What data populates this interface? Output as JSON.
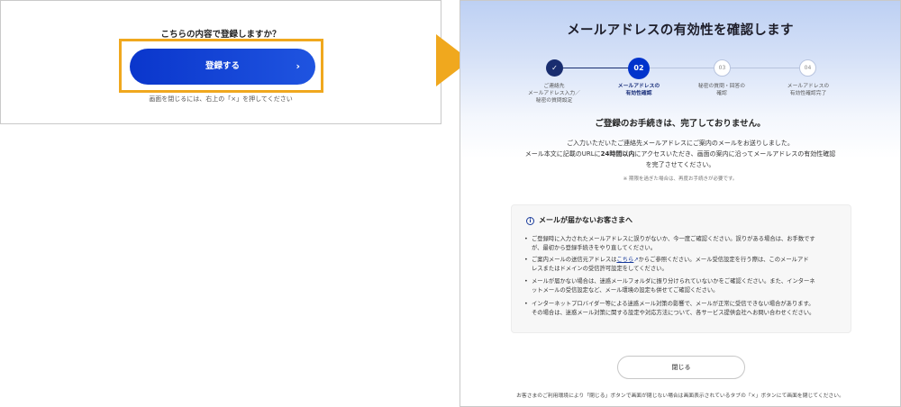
{
  "left_panel": {
    "question": "こちらの内容で登録しますか？",
    "register_button": "登録する",
    "register_chevron": "›",
    "close_note": "画面を閉じるには、右上の「×」を押してください"
  },
  "right_panel": {
    "title": "メールアドレスの有効性を確認します",
    "steps": [
      {
        "num": "✓",
        "label": "ご連絡先\nメールアドレス入力／\n秘密の質問設定",
        "state": "done"
      },
      {
        "num": "02",
        "label": "メールアドレスの\n有効性確認",
        "state": "current"
      },
      {
        "num": "03",
        "label": "秘密の質問・回答の\n確認",
        "state": "todo"
      },
      {
        "num": "04",
        "label": "メールアドレスの\n有効性確認完了",
        "state": "todo"
      }
    ],
    "status_heading": "ご登録のお手続きは、完了しておりません。",
    "info_line1": "ご入力いただいたご連絡先メールアドレスにご案内のメールをお送りしました。",
    "info_line2_pre": "メール本文に記載のURLに",
    "info_line2_bold": "24時間以内",
    "info_line2_post": "にアクセスいただき、画面の案内に沿ってメールアドレスの有効性確認",
    "info_line3": "を完了させてください。",
    "small_note": "※ 期限を過ぎた場合は、再度お手続きが必要です。",
    "notice": {
      "icon": "i",
      "title": "メールが届かないお客さまへ",
      "bullet": "•",
      "items": [
        {
          "text1": "ご登録時に入力されたメールアドレスに誤りがないか、今一度ご確認ください。誤りがある場合は、お手数です",
          "text2": "が、最初から登録手続きをやり直してください。"
        },
        {
          "pre": "ご案内メールの送信元アドレスは",
          "link": "こちら",
          "link_icon": "↗",
          "post": "からご参照ください。メール受信設定を行う際は、このメールアド",
          "text2": "レスまたはドメインの受信許可設定をしてください。"
        },
        {
          "text1": "メールが届かない場合は、迷惑メールフォルダに振り分けられていないかをご確認ください。また、インターネ",
          "text2": "ットメールの受信設定など、メール環境の設定も併せてご確認ください。"
        },
        {
          "text1": "インターネットプロバイダー等による迷惑メール対策の影響で、メールが正常に受信できない場合があります。",
          "text2": "その場合は、迷惑メール対策に関する設定や対応方法について、各サービス提供会社へお問い合わせください。"
        }
      ]
    },
    "close_button": "閉じる",
    "footer_note": "お客さまのご利用環境により「閉じる」ボタンで画面が閉じない場合は画面表示されているタブの「×」ボタンにて画面を閉じてください。"
  },
  "colors": {
    "accent_orange": "#f0a81e",
    "primary_blue": "#0033cc",
    "done_navy": "#192d6f"
  }
}
